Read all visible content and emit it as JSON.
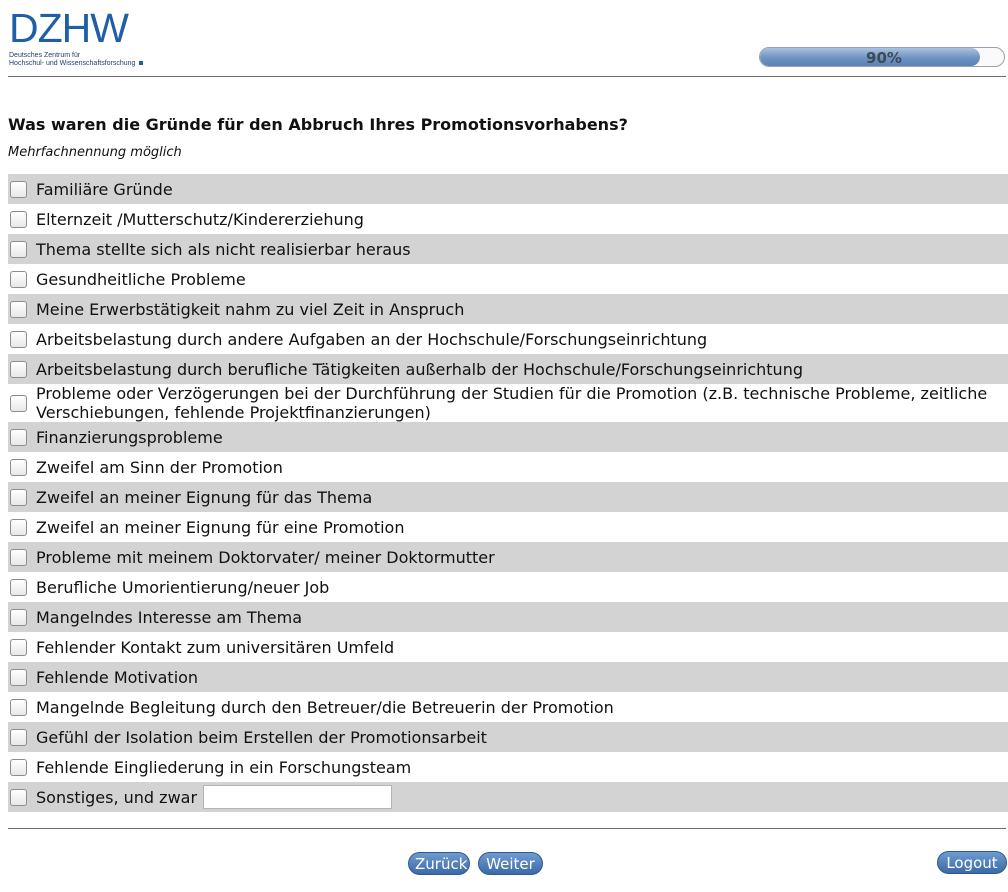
{
  "brand": {
    "logo_text": "DZHW",
    "subtitle_line1": "Deutsches Zentrum für",
    "subtitle_line2": "Hochschul- und Wissenschaftsforschung",
    "accent_color": "#1f5fa8"
  },
  "progress": {
    "value_percent": 90,
    "label": "90%"
  },
  "question": {
    "title": "Was waren die Gründe für den Abbruch Ihres Promotionsvorhabens?",
    "hint": "Mehrfachnennung möglich"
  },
  "options": [
    {
      "label": "Familiäre Gründe",
      "checked": false
    },
    {
      "label": "Elternzeit /Mutterschutz/Kindererziehung",
      "checked": false
    },
    {
      "label": "Thema stellte sich als nicht realisierbar heraus",
      "checked": false
    },
    {
      "label": "Gesundheitliche Probleme",
      "checked": false
    },
    {
      "label": "Meine Erwerbstätigkeit nahm zu viel Zeit in Anspruch",
      "checked": false
    },
    {
      "label": "Arbeitsbelastung durch andere Aufgaben an der Hochschule/Forschungseinrichtung",
      "checked": false
    },
    {
      "label": "Arbeitsbelastung durch berufliche Tätigkeiten außerhalb der Hochschule/Forschungseinrichtung",
      "checked": false
    },
    {
      "label": "Probleme oder Verzögerungen bei der Durchführung der Studien für die Promotion (z.B. technische Probleme, zeitliche Verschiebungen, fehlende Projektfinanzierungen)",
      "checked": false
    },
    {
      "label": "Finanzierungsprobleme",
      "checked": false
    },
    {
      "label": "Zweifel am Sinn der Promotion",
      "checked": false
    },
    {
      "label": "Zweifel an meiner Eignung für das Thema",
      "checked": false
    },
    {
      "label": "Zweifel an meiner Eignung für eine Promotion",
      "checked": false
    },
    {
      "label": "Probleme mit meinem Doktorvater/ meiner Doktormutter",
      "checked": false
    },
    {
      "label": "Berufliche Umorientierung/neuer Job",
      "checked": false
    },
    {
      "label": "Mangelndes Interesse am Thema",
      "checked": false
    },
    {
      "label": "Fehlender Kontakt zum universitären Umfeld",
      "checked": false
    },
    {
      "label": "Fehlende Motivation",
      "checked": false
    },
    {
      "label": "Mangelnde Begleitung durch den Betreuer/die Betreuerin der Promotion",
      "checked": false
    },
    {
      "label": "Gefühl der Isolation beim Erstellen der Promotionsarbeit",
      "checked": false
    },
    {
      "label": "Fehlende Eingliederung in ein Forschungsteam",
      "checked": false
    },
    {
      "label": "Sonstiges, und zwar",
      "checked": false
    }
  ],
  "other_input": {
    "value": "",
    "placeholder": ""
  },
  "nav": {
    "back_label": "Zurück",
    "next_label": "Weiter",
    "logout_label": "Logout"
  }
}
